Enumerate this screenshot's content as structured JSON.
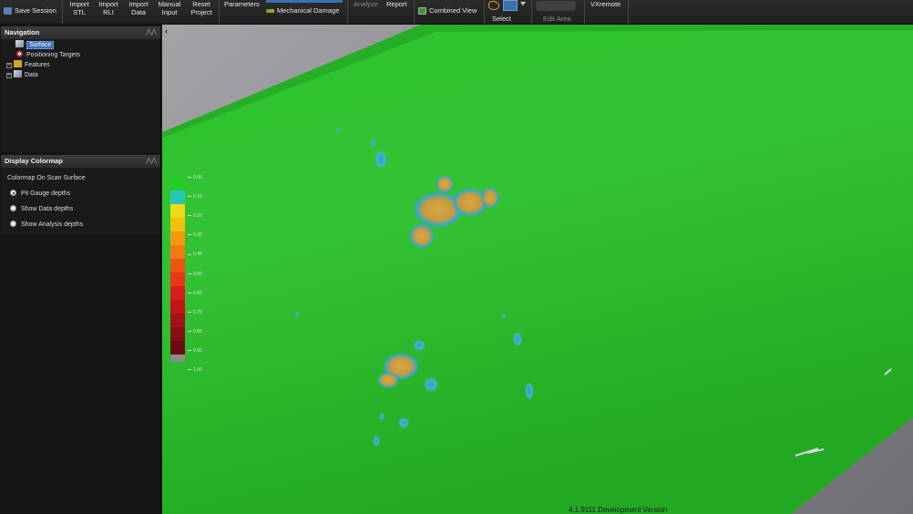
{
  "toolbar": {
    "save_session": "Save Session",
    "import_stl": [
      "Import",
      "STL"
    ],
    "import_rli": [
      "Import",
      "RLI"
    ],
    "import_data": [
      "Import",
      "Data"
    ],
    "manual_input": [
      "Manual",
      "Input"
    ],
    "reset_project": [
      "Reset",
      "Project"
    ],
    "parameters": "Parameters",
    "mechanical_damage": "Mechanical Damage",
    "analyze": "Analyze",
    "report": "Report",
    "combined_view": "Combined View",
    "select": "Select",
    "edit_area": "Edit Area",
    "vxremote": "VXremote"
  },
  "navigation": {
    "title": "Navigation",
    "items": [
      {
        "label": "Surface",
        "selected": true,
        "icon": "surface-icon"
      },
      {
        "label": "Positioning Targets",
        "icon": "targets-icon"
      },
      {
        "label": "Features",
        "icon": "features-icon",
        "expandable": true
      },
      {
        "label": "Data",
        "icon": "data-icon",
        "expandable": true
      }
    ]
  },
  "colormap_panel": {
    "title": "Display Colormap",
    "subtitle": "Colormap On Scan Surface",
    "options": [
      {
        "label": "Pit Gauge depths",
        "selected": true
      },
      {
        "label": "Show Data depths",
        "selected": false
      },
      {
        "label": "Show Analysis depths",
        "selected": false
      }
    ]
  },
  "legend": {
    "colors": [
      "#22cc22",
      "#27c7b8",
      "#f0d818",
      "#f2c012",
      "#f29a10",
      "#f07a12",
      "#ec5514",
      "#e8361a",
      "#d81e1c",
      "#c0151a",
      "#a4101a",
      "#861018",
      "#6a0c12",
      "#8c8c8c"
    ],
    "labels": [
      "0.00",
      "0.10",
      "0.20",
      "0.30",
      "0.40",
      "0.50",
      "0.60",
      "0.70",
      "0.80",
      "0.90",
      "1.00"
    ]
  },
  "status": "4.1.9111 Development Version"
}
